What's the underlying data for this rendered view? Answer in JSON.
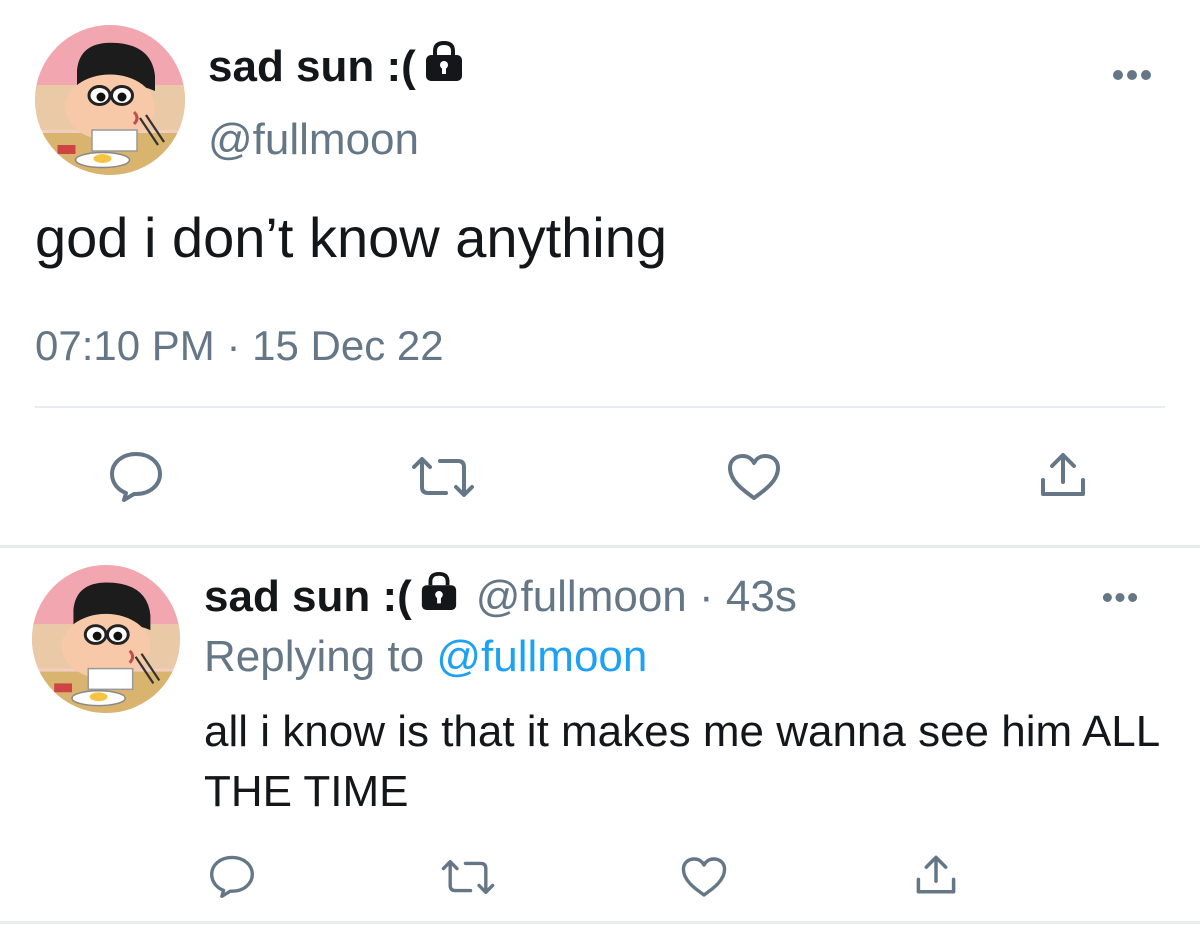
{
  "main_tweet": {
    "author": {
      "display_name": "sad sun :(",
      "handle": "@fullmoon",
      "protected": true,
      "avatar": "cartoon-boy-eating-avatar"
    },
    "text": "god i don’t know anything",
    "time": "07:10 PM",
    "separator": "·",
    "date": "15 Dec 22",
    "actions": [
      "reply-icon",
      "retweet-icon",
      "like-icon",
      "share-icon"
    ]
  },
  "reply_tweet": {
    "author": {
      "display_name": "sad sun :(",
      "handle": "@fullmoon",
      "protected": true,
      "avatar": "cartoon-boy-eating-avatar"
    },
    "handle_time": "@fullmoon · 43s",
    "replying_prefix": "Replying to",
    "replying_to": "@fullmoon",
    "text": "all i know is that it makes me wanna see him ALL THE TIME",
    "actions": [
      "reply-icon",
      "retweet-icon",
      "like-icon",
      "share-icon"
    ]
  },
  "colors": {
    "text": "#14171a",
    "secondary": "#657786",
    "link": "#1da1f2",
    "divider": "#e6ecf0"
  }
}
